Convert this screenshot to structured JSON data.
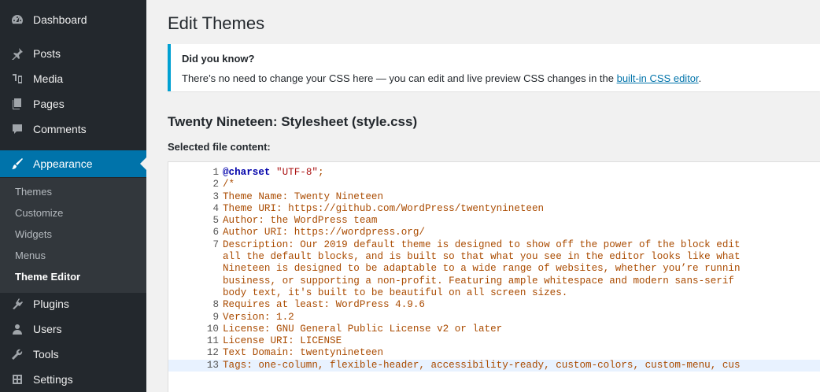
{
  "sidebar": {
    "menu": [
      {
        "label": "Dashboard",
        "icon": "dashboard-icon"
      },
      {
        "label": "Posts",
        "icon": "pin-icon"
      },
      {
        "label": "Media",
        "icon": "media-icon"
      },
      {
        "label": "Pages",
        "icon": "pages-icon"
      },
      {
        "label": "Comments",
        "icon": "comment-icon"
      },
      {
        "label": "Appearance",
        "icon": "paintbrush-icon"
      },
      {
        "label": "Plugins",
        "icon": "plugin-icon"
      },
      {
        "label": "Users",
        "icon": "users-icon"
      },
      {
        "label": "Tools",
        "icon": "wrench-icon"
      },
      {
        "label": "Settings",
        "icon": "settings-icon"
      }
    ],
    "submenu": [
      "Themes",
      "Customize",
      "Widgets",
      "Menus",
      "Theme Editor"
    ]
  },
  "main": {
    "title": "Edit Themes",
    "notice": {
      "heading": "Did you know?",
      "text": "There’s no need to change your CSS here — you can edit and live preview CSS changes in the ",
      "link": "built-in CSS editor",
      "suffix": "."
    },
    "file_heading": "Twenty Nineteen: Stylesheet (style.css)",
    "content_label": "Selected file content:",
    "editor_lines": [
      {
        "n": "1",
        "at": "@charset",
        "str": " \"UTF-8\"",
        "text": ";"
      },
      {
        "n": "2",
        "text": "/*"
      },
      {
        "n": "3",
        "text": "Theme Name: Twenty Nineteen"
      },
      {
        "n": "4",
        "text": "Theme URI: https://github.com/WordPress/twentynineteen"
      },
      {
        "n": "5",
        "text": "Author: the WordPress team"
      },
      {
        "n": "6",
        "text": "Author URI: https://wordpress.org/"
      },
      {
        "n": "7",
        "text": "Description: Our 2019 default theme is designed to show off the power of the block edit"
      },
      {
        "n": "",
        "text": "all the default blocks, and is built so that what you see in the editor looks like what"
      },
      {
        "n": "",
        "text": "Nineteen is designed to be adaptable to a wide range of websites, whether you’re runnin"
      },
      {
        "n": "",
        "text": "business, or supporting a non-profit. Featuring ample whitespace and modern sans-serif"
      },
      {
        "n": "",
        "text": "body text, it's built to be beautiful on all screen sizes."
      },
      {
        "n": "8",
        "text": "Requires at least: WordPress 4.9.6"
      },
      {
        "n": "9",
        "text": "Version: 1.2"
      },
      {
        "n": "10",
        "text": "License: GNU General Public License v2 or later"
      },
      {
        "n": "11",
        "text": "License URI: LICENSE"
      },
      {
        "n": "12",
        "text": "Text Domain: twentynineteen"
      },
      {
        "n": "13",
        "text": "Tags: one-column, flexible-header, accessibility-ready, custom-colors, custom-menu, cus"
      }
    ]
  },
  "colors": {
    "sidebar_bg": "#23282d",
    "submenu_bg": "#32373c",
    "active_blue": "#0073aa",
    "notice_border": "#00a0d2",
    "code_text": "#aa4b00"
  }
}
